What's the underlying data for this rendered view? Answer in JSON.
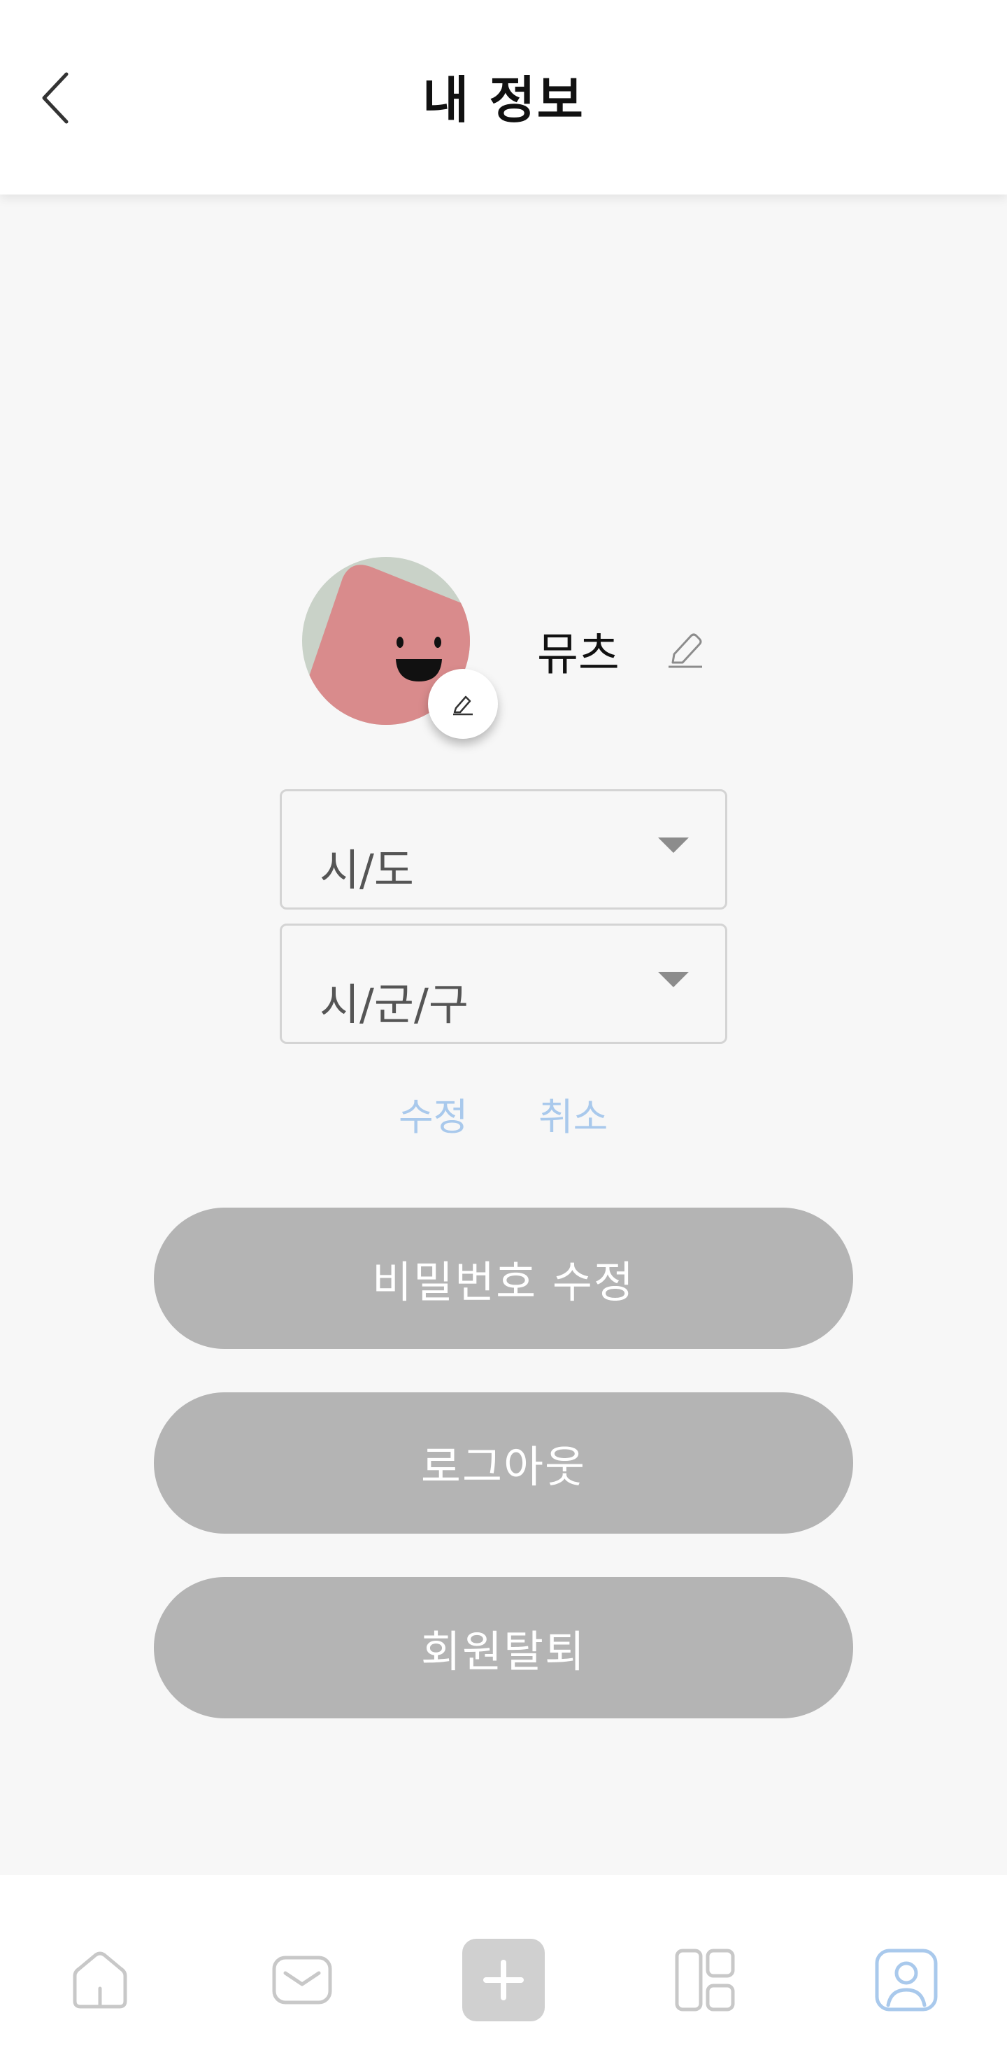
{
  "header": {
    "title": "내 정보",
    "back_icon": "chevron-left-icon"
  },
  "profile": {
    "nickname": "뮤츠",
    "avatar_colors": {
      "background": "#c9d2c8",
      "face": "#d98b8c"
    },
    "avatar_edit_icon": "pencil-icon",
    "nickname_edit_icon": "pencil-icon"
  },
  "location": {
    "sido_placeholder": "시/도",
    "sigungu_placeholder": "시/군/구"
  },
  "actions": {
    "confirm_label": "수정",
    "cancel_label": "취소"
  },
  "buttons": {
    "change_password": "비밀번호 수정",
    "logout": "로그아웃",
    "withdraw": "회원탈퇴"
  },
  "bottom_nav": {
    "items": [
      {
        "icon": "home-icon",
        "active": false
      },
      {
        "icon": "inbox-icon",
        "active": false
      },
      {
        "icon": "plus-icon",
        "active": false
      },
      {
        "icon": "grid-icon",
        "active": false
      },
      {
        "icon": "profile-icon",
        "active": true
      }
    ],
    "active_color": "#a9c9ec",
    "inactive_color": "#c8c8c8"
  }
}
